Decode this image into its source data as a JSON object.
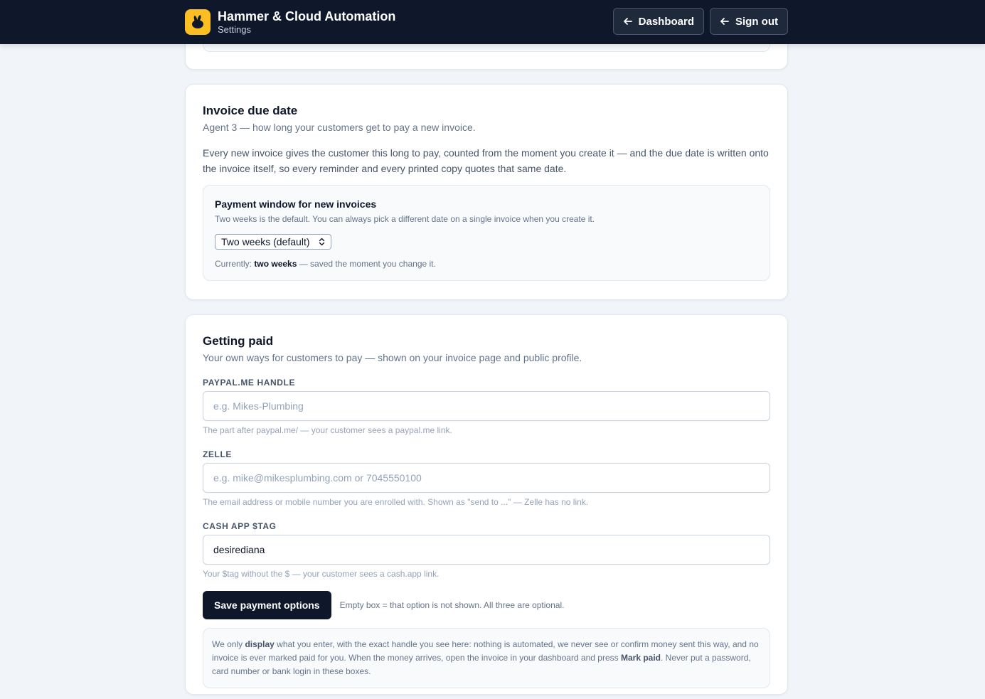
{
  "header": {
    "app_title": "Hammer & Cloud Automation",
    "app_subtitle": "Settings",
    "dashboard_label": "Dashboard",
    "signout_label": "Sign out"
  },
  "invoice_due": {
    "title": "Invoice due date",
    "subtitle": "Agent 3 — how long your customers get to pay a new invoice.",
    "description": "Every new invoice gives the customer this long to pay, counted from the moment you create it — and the due date is written onto the invoice itself, so every reminder and every printed copy quotes that same date.",
    "panel": {
      "title": "Payment window for new invoices",
      "help": "Two weeks is the default. You can always pick a different date on a single invoice when you create it.",
      "selected": "Two weeks (default)",
      "status_prefix": "Currently: ",
      "status_value": "two weeks",
      "status_suffix": " — saved the moment you change it."
    }
  },
  "getting_paid": {
    "title": "Getting paid",
    "subtitle": "Your own ways for customers to pay — shown on your invoice page and public profile.",
    "fields": [
      {
        "label": "PAYPAL.ME HANDLE",
        "value": "",
        "placeholder": "e.g. Mikes-Plumbing",
        "help": "The part after paypal.me/ — your customer sees a paypal.me link."
      },
      {
        "label": "ZELLE",
        "value": "",
        "placeholder": "e.g. mike@mikesplumbing.com or 7045550100",
        "help": "The email address or mobile number you are enrolled with. Shown as \"send to ...\" — Zelle has no link."
      },
      {
        "label": "CASH APP $TAG",
        "value": "desirediana",
        "placeholder": "",
        "help": "Your $tag without the $ — your customer sees a cash.app link."
      }
    ],
    "save_label": "Save payment options",
    "save_note": "Empty box = that option is not shown. All three are optional.",
    "notice": {
      "p1": "We only ",
      "b1": "display",
      "p2": " what you enter, with the exact handle you see here: nothing is automated, we never see or confirm money sent this way, and no invoice is ever marked paid for you. When the money arrives, open the invoice in your dashboard and press ",
      "b2": "Mark paid",
      "p3": ". Never put a password, card number or bank login in these boxes."
    }
  },
  "colors": {
    "header_bg": "#0f172a",
    "logo_bg": "#fbbf24",
    "primary_button": "#0f172a",
    "page_bg": "#f1f4f8"
  },
  "icons": {
    "logo": "rabbit-logo-icon",
    "back": "arrow-left-icon",
    "select": "chevron-up-down-icon"
  }
}
